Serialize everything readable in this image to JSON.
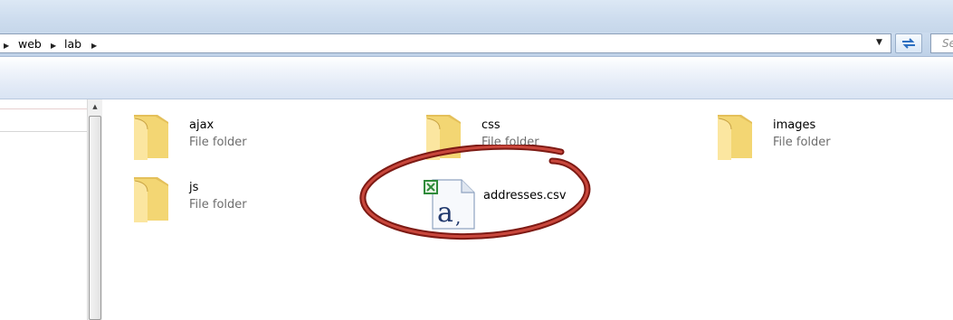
{
  "breadcrumb": {
    "items": [
      "web",
      "lab"
    ]
  },
  "search": {
    "placeholder": "Se"
  },
  "files": [
    {
      "name": "ajax",
      "type": "File folder",
      "icon": "folder-icon"
    },
    {
      "name": "css",
      "type": "File folder",
      "icon": "folder-icon"
    },
    {
      "name": "images",
      "type": "File folder",
      "icon": "folder-icon"
    },
    {
      "name": "js",
      "type": "File folder",
      "icon": "folder-icon"
    },
    {
      "name": "addresses.csv",
      "icon": "csv-file-icon"
    }
  ],
  "colors": {
    "callout_ring": "#b52a23",
    "folder": "#f1d36f"
  }
}
